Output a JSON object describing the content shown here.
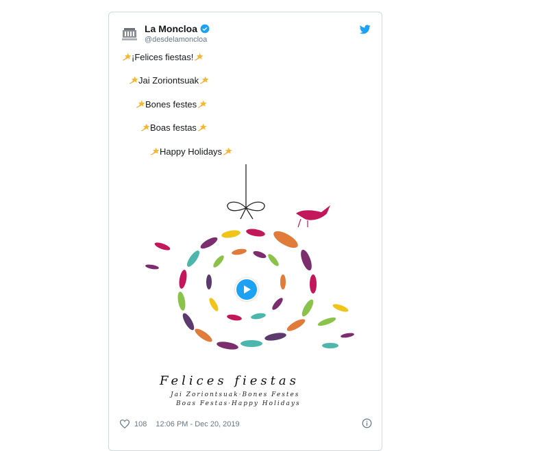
{
  "tweet": {
    "author_name": "La Moncloa",
    "author_handle": "@desdelamoncloa",
    "avatar_text": "La Moncloa",
    "lines": [
      "¡Felices fiestas!",
      "Jai Zoriontsuak",
      "Bones festes",
      "Boas festas",
      "Happy Holidays"
    ],
    "media": {
      "title": "Felices fiestas",
      "subtitle_line1": "Jai Zoriontsuak·Bones Festes",
      "subtitle_line2": "Boas Festas·Happy Holidays"
    },
    "like_count": "108",
    "timestamp": "12:06 PM - Dec 20, 2019"
  },
  "colors": {
    "twitter_blue": "#1da1f2",
    "text": "#14171a",
    "muted": "#657786",
    "border": "#cfd9de"
  },
  "icons": {
    "verified": "verified-icon",
    "bird": "twitter-bird-icon",
    "star": "dizzy-star-icon",
    "heart": "heart-icon",
    "info": "info-icon",
    "play": "play-icon"
  }
}
